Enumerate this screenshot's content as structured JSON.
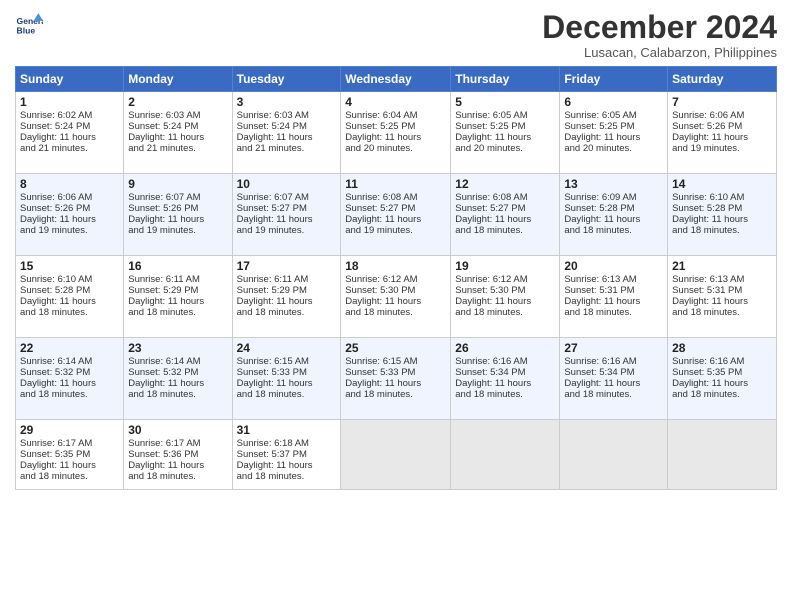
{
  "header": {
    "logo_line1": "General",
    "logo_line2": "Blue",
    "month_title": "December 2024",
    "location": "Lusacan, Calabarzon, Philippines"
  },
  "days_of_week": [
    "Sunday",
    "Monday",
    "Tuesday",
    "Wednesday",
    "Thursday",
    "Friday",
    "Saturday"
  ],
  "weeks": [
    [
      {
        "day": "1",
        "lines": [
          "Sunrise: 6:02 AM",
          "Sunset: 5:24 PM",
          "Daylight: 11 hours",
          "and 21 minutes."
        ]
      },
      {
        "day": "2",
        "lines": [
          "Sunrise: 6:03 AM",
          "Sunset: 5:24 PM",
          "Daylight: 11 hours",
          "and 21 minutes."
        ]
      },
      {
        "day": "3",
        "lines": [
          "Sunrise: 6:03 AM",
          "Sunset: 5:24 PM",
          "Daylight: 11 hours",
          "and 21 minutes."
        ]
      },
      {
        "day": "4",
        "lines": [
          "Sunrise: 6:04 AM",
          "Sunset: 5:25 PM",
          "Daylight: 11 hours",
          "and 20 minutes."
        ]
      },
      {
        "day": "5",
        "lines": [
          "Sunrise: 6:05 AM",
          "Sunset: 5:25 PM",
          "Daylight: 11 hours",
          "and 20 minutes."
        ]
      },
      {
        "day": "6",
        "lines": [
          "Sunrise: 6:05 AM",
          "Sunset: 5:25 PM",
          "Daylight: 11 hours",
          "and 20 minutes."
        ]
      },
      {
        "day": "7",
        "lines": [
          "Sunrise: 6:06 AM",
          "Sunset: 5:26 PM",
          "Daylight: 11 hours",
          "and 19 minutes."
        ]
      }
    ],
    [
      {
        "day": "8",
        "lines": [
          "Sunrise: 6:06 AM",
          "Sunset: 5:26 PM",
          "Daylight: 11 hours",
          "and 19 minutes."
        ]
      },
      {
        "day": "9",
        "lines": [
          "Sunrise: 6:07 AM",
          "Sunset: 5:26 PM",
          "Daylight: 11 hours",
          "and 19 minutes."
        ]
      },
      {
        "day": "10",
        "lines": [
          "Sunrise: 6:07 AM",
          "Sunset: 5:27 PM",
          "Daylight: 11 hours",
          "and 19 minutes."
        ]
      },
      {
        "day": "11",
        "lines": [
          "Sunrise: 6:08 AM",
          "Sunset: 5:27 PM",
          "Daylight: 11 hours",
          "and 19 minutes."
        ]
      },
      {
        "day": "12",
        "lines": [
          "Sunrise: 6:08 AM",
          "Sunset: 5:27 PM",
          "Daylight: 11 hours",
          "and 18 minutes."
        ]
      },
      {
        "day": "13",
        "lines": [
          "Sunrise: 6:09 AM",
          "Sunset: 5:28 PM",
          "Daylight: 11 hours",
          "and 18 minutes."
        ]
      },
      {
        "day": "14",
        "lines": [
          "Sunrise: 6:10 AM",
          "Sunset: 5:28 PM",
          "Daylight: 11 hours",
          "and 18 minutes."
        ]
      }
    ],
    [
      {
        "day": "15",
        "lines": [
          "Sunrise: 6:10 AM",
          "Sunset: 5:28 PM",
          "Daylight: 11 hours",
          "and 18 minutes."
        ]
      },
      {
        "day": "16",
        "lines": [
          "Sunrise: 6:11 AM",
          "Sunset: 5:29 PM",
          "Daylight: 11 hours",
          "and 18 minutes."
        ]
      },
      {
        "day": "17",
        "lines": [
          "Sunrise: 6:11 AM",
          "Sunset: 5:29 PM",
          "Daylight: 11 hours",
          "and 18 minutes."
        ]
      },
      {
        "day": "18",
        "lines": [
          "Sunrise: 6:12 AM",
          "Sunset: 5:30 PM",
          "Daylight: 11 hours",
          "and 18 minutes."
        ]
      },
      {
        "day": "19",
        "lines": [
          "Sunrise: 6:12 AM",
          "Sunset: 5:30 PM",
          "Daylight: 11 hours",
          "and 18 minutes."
        ]
      },
      {
        "day": "20",
        "lines": [
          "Sunrise: 6:13 AM",
          "Sunset: 5:31 PM",
          "Daylight: 11 hours",
          "and 18 minutes."
        ]
      },
      {
        "day": "21",
        "lines": [
          "Sunrise: 6:13 AM",
          "Sunset: 5:31 PM",
          "Daylight: 11 hours",
          "and 18 minutes."
        ]
      }
    ],
    [
      {
        "day": "22",
        "lines": [
          "Sunrise: 6:14 AM",
          "Sunset: 5:32 PM",
          "Daylight: 11 hours",
          "and 18 minutes."
        ]
      },
      {
        "day": "23",
        "lines": [
          "Sunrise: 6:14 AM",
          "Sunset: 5:32 PM",
          "Daylight: 11 hours",
          "and 18 minutes."
        ]
      },
      {
        "day": "24",
        "lines": [
          "Sunrise: 6:15 AM",
          "Sunset: 5:33 PM",
          "Daylight: 11 hours",
          "and 18 minutes."
        ]
      },
      {
        "day": "25",
        "lines": [
          "Sunrise: 6:15 AM",
          "Sunset: 5:33 PM",
          "Daylight: 11 hours",
          "and 18 minutes."
        ]
      },
      {
        "day": "26",
        "lines": [
          "Sunrise: 6:16 AM",
          "Sunset: 5:34 PM",
          "Daylight: 11 hours",
          "and 18 minutes."
        ]
      },
      {
        "day": "27",
        "lines": [
          "Sunrise: 6:16 AM",
          "Sunset: 5:34 PM",
          "Daylight: 11 hours",
          "and 18 minutes."
        ]
      },
      {
        "day": "28",
        "lines": [
          "Sunrise: 6:16 AM",
          "Sunset: 5:35 PM",
          "Daylight: 11 hours",
          "and 18 minutes."
        ]
      }
    ],
    [
      {
        "day": "29",
        "lines": [
          "Sunrise: 6:17 AM",
          "Sunset: 5:35 PM",
          "Daylight: 11 hours",
          "and 18 minutes."
        ]
      },
      {
        "day": "30",
        "lines": [
          "Sunrise: 6:17 AM",
          "Sunset: 5:36 PM",
          "Daylight: 11 hours",
          "and 18 minutes."
        ]
      },
      {
        "day": "31",
        "lines": [
          "Sunrise: 6:18 AM",
          "Sunset: 5:37 PM",
          "Daylight: 11 hours",
          "and 18 minutes."
        ]
      },
      {
        "day": "",
        "lines": []
      },
      {
        "day": "",
        "lines": []
      },
      {
        "day": "",
        "lines": []
      },
      {
        "day": "",
        "lines": []
      }
    ]
  ]
}
